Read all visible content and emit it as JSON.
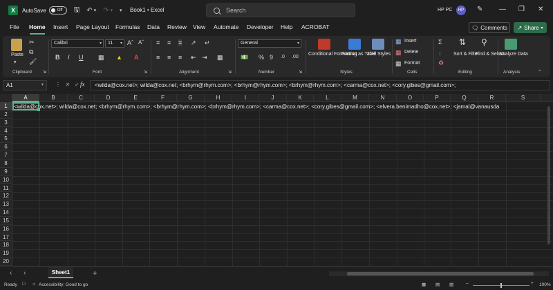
{
  "titlebar": {
    "app_logo": "X",
    "autosave_label": "AutoSave",
    "autosave_state": "Off",
    "doc_title": "Book1  •  Excel",
    "search_placeholder": "Search",
    "user_name": "HP PC",
    "user_initials": "HP"
  },
  "menu": {
    "tabs": [
      "File",
      "Home",
      "Insert",
      "Page Layout",
      "Formulas",
      "Data",
      "Review",
      "View",
      "Automate",
      "Developer",
      "Help",
      "ACROBAT"
    ],
    "active_tab": "Home",
    "comments_label": "Comments",
    "share_label": "Share"
  },
  "ribbon": {
    "groups": [
      "Clipboard",
      "Font",
      "Alignment",
      "Number",
      "Styles",
      "Cells",
      "Editing",
      "Analysis"
    ],
    "paste_label": "Paste",
    "font_name": "Calibri",
    "font_size": "11",
    "number_format": "General",
    "conditional_formatting": "Conditional Formatting",
    "format_as_table": "Format as Table",
    "cell_styles": "Cell Styles",
    "insert_label": "Insert",
    "delete_label": "Delete",
    "format_label": "Format",
    "sort_filter": "Sort & Filter",
    "find_select": "Find & Select",
    "analyze_data": "Analyze Data"
  },
  "formula_bar": {
    "name_box": "A1",
    "fx": "fx",
    "content": "<wilda@cox.net>; wilda@cox.net;  <brhym@rhym.com>;  <brhym@rhym.com>;  <brhym@rhym.com>;  <carma@cox.net>;  <cory.gibes@gmail.com>;"
  },
  "grid": {
    "columns": [
      "A",
      "B",
      "C",
      "D",
      "E",
      "F",
      "G",
      "H",
      "I",
      "J",
      "K",
      "L",
      "M",
      "N",
      "O",
      "P",
      "Q",
      "R",
      "S"
    ],
    "rows": [
      "1",
      "2",
      "3",
      "4",
      "5",
      "6",
      "7",
      "8",
      "9",
      "10",
      "11",
      "12",
      "13",
      "14",
      "15",
      "16",
      "17",
      "18",
      "19",
      "20"
    ],
    "selected_cell": "A1",
    "a1_value": "<wilda@cox.net>; wilda@cox.net;  <brhym@rhym.com>;  <brhym@rhym.com>;  <brhym@rhym.com>;  <carma@cox.net>;  <cory.gibes@gmail.com>;  <elvera.benimadho@cox.net>;  <jamal@vanausda"
  },
  "sheets": {
    "tabs": [
      "Sheet1"
    ]
  },
  "status": {
    "ready": "Ready",
    "accessibility": "Accessibility: Good to go",
    "zoom": "100%"
  },
  "colors": {
    "accent": "#5fb48a",
    "excel_green": "#107c41",
    "background": "#1f1f1f"
  }
}
